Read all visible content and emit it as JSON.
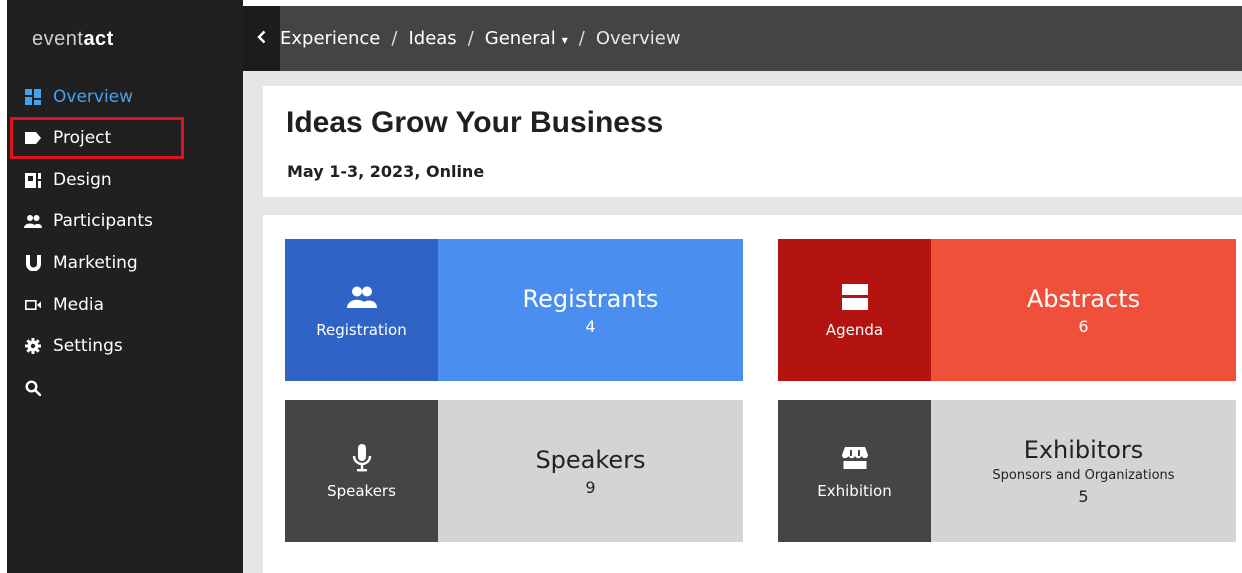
{
  "app": {
    "logo_light": "event",
    "logo_bold": "act"
  },
  "sidebar": {
    "items": [
      {
        "label": "Overview",
        "icon": "dashboard-icon"
      },
      {
        "label": "Project",
        "icon": "tag-icon"
      },
      {
        "label": "Design",
        "icon": "design-icon"
      },
      {
        "label": "Participants",
        "icon": "people-icon"
      },
      {
        "label": "Marketing",
        "icon": "magnet-icon"
      },
      {
        "label": "Media",
        "icon": "video-icon"
      },
      {
        "label": "Settings",
        "icon": "gear-icon"
      }
    ],
    "search_icon": "search-icon",
    "active": "Overview",
    "highlighted": "Project"
  },
  "topbar": {
    "back_icon": "chevron-left-icon",
    "crumbs": [
      "Experience",
      "Ideas",
      "General",
      "Overview"
    ],
    "separator": "/"
  },
  "header": {
    "title": "Ideas Grow Your Business",
    "subtitle": "May 1-3, 2023, Online"
  },
  "tiles": {
    "registration": {
      "left_label": "Registration",
      "title": "Registrants",
      "count": "4"
    },
    "agenda": {
      "left_label": "Agenda",
      "title": "Abstracts",
      "count": "6"
    },
    "speakers": {
      "left_label": "Speakers",
      "title": "Speakers",
      "count": "9"
    },
    "exhibition": {
      "left_label": "Exhibition",
      "title": "Exhibitors",
      "subtitle": "Sponsors and Organizations",
      "count": "5"
    }
  },
  "colors": {
    "blue_dark": "#2f63c5",
    "blue_light": "#4a8ff0",
    "red_dark": "#b3140f",
    "red_light": "#f0503a",
    "gray_dark": "#454545",
    "gray_light": "#d4d4d4",
    "accent": "#48a0f0",
    "highlight": "#e0131e"
  }
}
